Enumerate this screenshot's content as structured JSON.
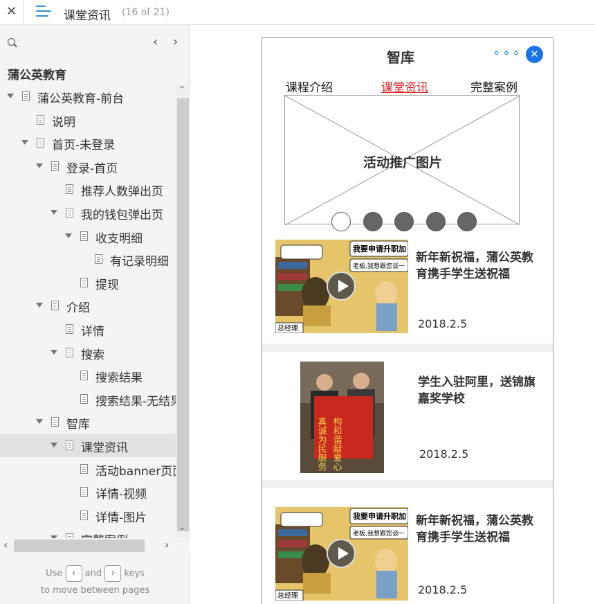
{
  "topbar": {
    "close_glyph": "✕",
    "title": "课堂资讯",
    "count": "(16 of 21)"
  },
  "sidebar": {
    "prev_glyph": "‹",
    "next_glyph": "›",
    "project": "蒲公英教育",
    "tree": [
      {
        "label": "蒲公英教育-前台",
        "level": 0,
        "arrow": true
      },
      {
        "label": "说明",
        "level": 1,
        "arrow": false
      },
      {
        "label": "首页-未登录",
        "level": 1,
        "arrow": true
      },
      {
        "label": "登录-首页",
        "level": 2,
        "arrow": true
      },
      {
        "label": "推荐人数弹出页",
        "level": 3,
        "arrow": false
      },
      {
        "label": "我的钱包弹出页",
        "level": 3,
        "arrow": true
      },
      {
        "label": "收支明细",
        "level": 4,
        "arrow": true
      },
      {
        "label": "有记录明细",
        "level": 5,
        "arrow": false
      },
      {
        "label": "提现",
        "level": 4,
        "arrow": false
      },
      {
        "label": "介绍",
        "level": 2,
        "arrow": true
      },
      {
        "label": "详情",
        "level": 3,
        "arrow": false
      },
      {
        "label": "搜索",
        "level": 3,
        "arrow": true
      },
      {
        "label": "搜索结果",
        "level": 4,
        "arrow": false
      },
      {
        "label": "搜索结果-无结果",
        "level": 4,
        "arrow": false
      },
      {
        "label": "智库",
        "level": 2,
        "arrow": true
      },
      {
        "label": "课堂资讯",
        "level": 3,
        "arrow": true,
        "selected": true
      },
      {
        "label": "活动banner页面",
        "level": 4,
        "arrow": false
      },
      {
        "label": "详情-视频",
        "level": 4,
        "arrow": false
      },
      {
        "label": "详情-图片",
        "level": 4,
        "arrow": false
      },
      {
        "label": "完整案例",
        "level": 3,
        "arrow": true
      }
    ],
    "hint_use": "Use",
    "hint_and": "and",
    "hint_keys": "keys",
    "hint_line2": "to move between pages",
    "key_prev": "‹",
    "key_next": "›"
  },
  "phone": {
    "title": "智库",
    "more_glyph": "∘∘∘",
    "close_glyph": "✕",
    "tabs": [
      "课程介绍",
      "课堂资讯",
      "完整案例"
    ],
    "active_tab": 1,
    "banner_label": "活动推广图片",
    "indicator_count": 5,
    "active_indicator": 0,
    "news": [
      {
        "title": "新年新祝福，蒲公英教育携手学生送祝福",
        "date": "2018.2.5",
        "media": "video",
        "caption_top": "我要申请升职加",
        "caption_mid": "老板,我想跟您谈一",
        "caption_sign": "总经理"
      },
      {
        "title": "学生入驻阿里，送锦旗嘉奖学校",
        "date": "2018.2.5",
        "media": "photo",
        "banner_text1": "真诚为民服务",
        "banner_text2": "构和谐献爱心"
      },
      {
        "title": "新年新祝福，蒲公英教育携手学生送祝福",
        "date": "2018.2.5",
        "media": "video",
        "caption_top": "我要申请升职加",
        "caption_mid": "老板,我想跟您谈一",
        "caption_sign": "总经理"
      }
    ]
  },
  "colors": {
    "accent": "#1a73e8",
    "active_tab": "#e02020",
    "menu_icon": "#2a8fd8"
  }
}
